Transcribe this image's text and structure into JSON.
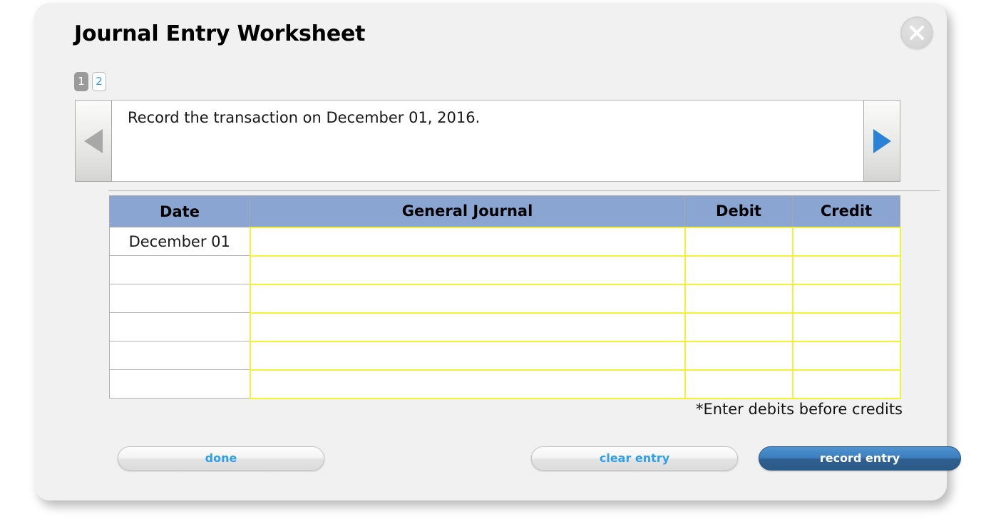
{
  "dialog": {
    "title": "Journal Entry Worksheet",
    "close_icon": "close-icon"
  },
  "tabs": [
    {
      "label": "1",
      "state": "active"
    },
    {
      "label": "2",
      "state": "inactive"
    }
  ],
  "navigation": {
    "prev_icon": "triangle-left-icon",
    "next_icon": "triangle-right-icon",
    "prev_color": "#a8a8a8",
    "next_color": "#2981d8"
  },
  "instruction": {
    "text": "Record the transaction on December 01, 2016."
  },
  "table": {
    "headers": [
      "Date",
      "General Journal",
      "Debit",
      "Credit"
    ],
    "rows": [
      {
        "date": "December 01",
        "general_journal": "",
        "debit": "",
        "credit": ""
      },
      {
        "date": "",
        "general_journal": "",
        "debit": "",
        "credit": ""
      },
      {
        "date": "",
        "general_journal": "",
        "debit": "",
        "credit": ""
      },
      {
        "date": "",
        "general_journal": "",
        "debit": "",
        "credit": ""
      },
      {
        "date": "",
        "general_journal": "",
        "debit": "",
        "credit": ""
      },
      {
        "date": "",
        "general_journal": "",
        "debit": "",
        "credit": ""
      }
    ],
    "header_color": "#8ba5d3",
    "input_border_color": "#f3f13a"
  },
  "footnote": "*Enter debits before credits",
  "buttons": {
    "done": "done",
    "clear_entry": "clear entry",
    "record_entry": "record entry"
  },
  "colors": {
    "accent_blue": "#2e9fe8",
    "primary_button": "#3d7fc0",
    "dialog_background": "#f1f1f1"
  }
}
